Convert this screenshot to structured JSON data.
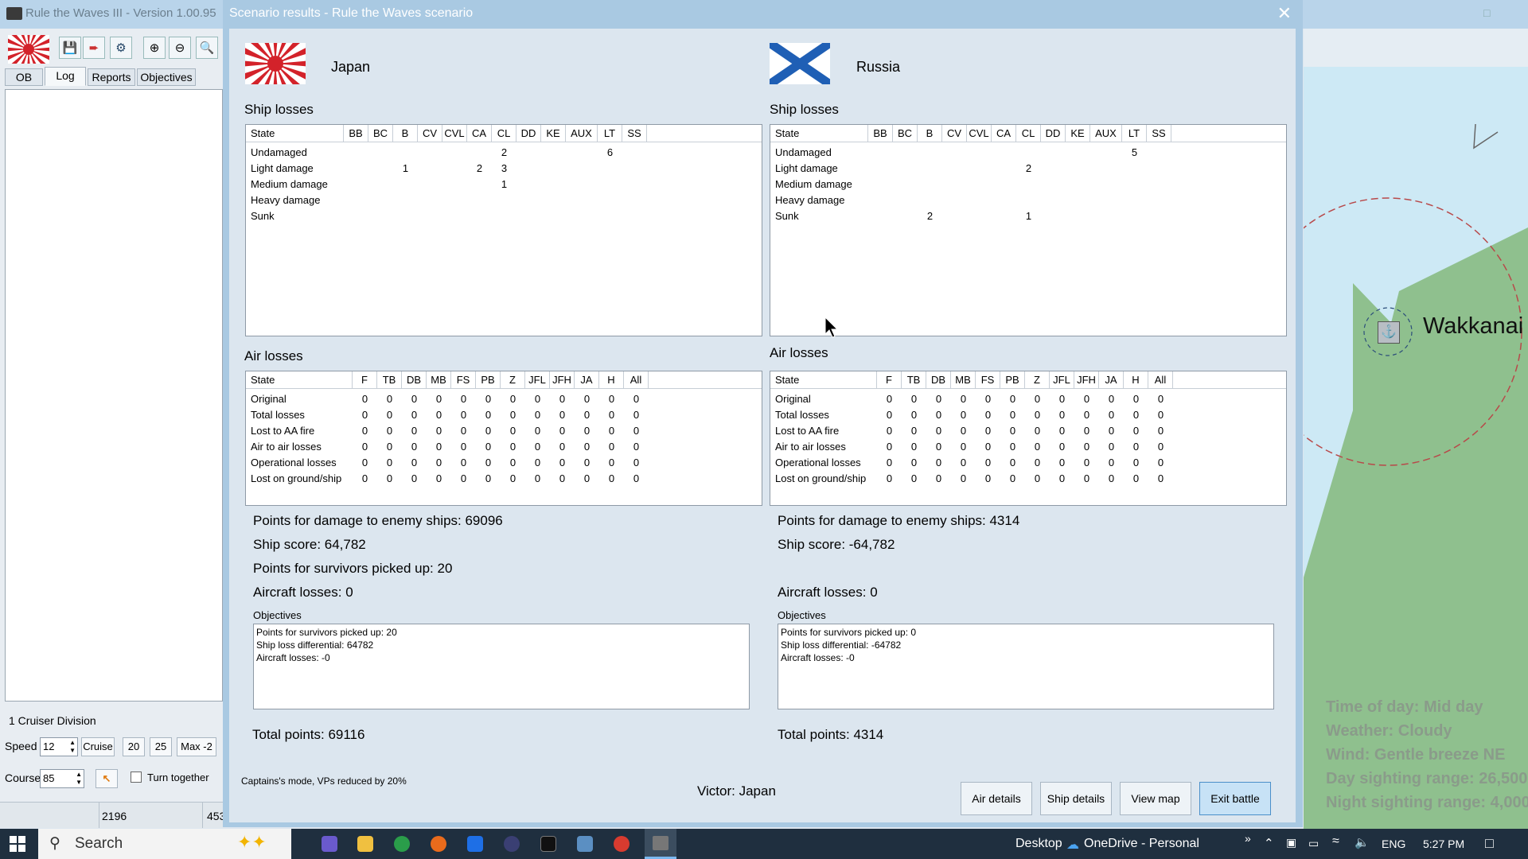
{
  "app": {
    "title": "Rule the Waves III - Version 1.00.95",
    "tabs": [
      "OB",
      "Log",
      "Reports",
      "Objectives"
    ],
    "active_tab": "Log",
    "unit_name": "1 Cruiser Division",
    "speed_label": "Speed",
    "speed_value": "12",
    "speed_buttons": [
      "Cruise",
      "20",
      "25",
      "Max -2"
    ],
    "course_label": "Course",
    "course_value": "85",
    "turn_together_label": "Turn together",
    "status_values": [
      "2196",
      "453"
    ]
  },
  "map": {
    "place_name": "Wakkanai",
    "info": {
      "time": "Time of day: Mid day",
      "weather": "Weather: Cloudy",
      "wind": "Wind: Gentle breeze  NE",
      "day_range": "Day sighting range: 26,500",
      "night_range": "Night sighting range: 4,000"
    }
  },
  "dialog": {
    "title": "Scenario results - Rule the Waves scenario",
    "ship_losses_title": "Ship losses",
    "air_losses_title": "Air losses",
    "ship_columns": [
      "State",
      "BB",
      "BC",
      "B",
      "CV",
      "CVL",
      "CA",
      "CL",
      "DD",
      "KE",
      "AUX",
      "LT",
      "SS"
    ],
    "air_columns": [
      "State",
      "F",
      "TB",
      "DB",
      "MB",
      "FS",
      "PB",
      "Z",
      "JFL",
      "JFH",
      "JA",
      "H",
      "All"
    ],
    "objectives_label": "Objectives",
    "captains_mode_note": "Captains's mode, VPs reduced by 20%",
    "victor": "Victor: Japan",
    "buttons": {
      "air_details": "Air details",
      "ship_details": "Ship details",
      "view_map": "View map",
      "exit_battle": "Exit battle"
    }
  },
  "japan": {
    "name": "Japan",
    "ship_rows": [
      [
        "Undamaged",
        "",
        "",
        "",
        "",
        "",
        "",
        "2",
        "",
        "",
        "",
        "6",
        ""
      ],
      [
        "Light damage",
        "",
        "",
        "1",
        "",
        "",
        "2",
        "3",
        "",
        "",
        "",
        "",
        ""
      ],
      [
        "Medium damage",
        "",
        "",
        "",
        "",
        "",
        "",
        "1",
        "",
        "",
        "",
        "",
        ""
      ],
      [
        "Heavy damage",
        "",
        "",
        "",
        "",
        "",
        "",
        "",
        "",
        "",
        "",
        "",
        ""
      ],
      [
        "Sunk",
        "",
        "",
        "",
        "",
        "",
        "",
        "",
        "",
        "",
        "",
        "",
        ""
      ]
    ],
    "air_rows": [
      [
        "Original",
        "0",
        "0",
        "0",
        "0",
        "0",
        "0",
        "0",
        "0",
        "0",
        "0",
        "0",
        "0"
      ],
      [
        "Total losses",
        "0",
        "0",
        "0",
        "0",
        "0",
        "0",
        "0",
        "0",
        "0",
        "0",
        "0",
        "0"
      ],
      [
        "Lost to AA fire",
        "0",
        "0",
        "0",
        "0",
        "0",
        "0",
        "0",
        "0",
        "0",
        "0",
        "0",
        "0"
      ],
      [
        "Air to air losses",
        "0",
        "0",
        "0",
        "0",
        "0",
        "0",
        "0",
        "0",
        "0",
        "0",
        "0",
        "0"
      ],
      [
        "Operational losses",
        "0",
        "0",
        "0",
        "0",
        "0",
        "0",
        "0",
        "0",
        "0",
        "0",
        "0",
        "0"
      ],
      [
        "Lost on ground/ship",
        "0",
        "0",
        "0",
        "0",
        "0",
        "0",
        "0",
        "0",
        "0",
        "0",
        "0",
        "0"
      ]
    ],
    "points_damage": "Points for damage to enemy ships: 69096",
    "ship_score": "Ship score: 64,782",
    "points_survivors": "Points for survivors picked up: 20",
    "aircraft_losses": "Aircraft losses: 0",
    "objectives": [
      "Points for survivors picked up: 20",
      "Ship loss differential: 64782",
      "Aircraft losses: -0"
    ],
    "total_points": "Total points: 69116"
  },
  "russia": {
    "name": "Russia",
    "ship_rows": [
      [
        "Undamaged",
        "",
        "",
        "",
        "",
        "",
        "",
        "",
        "",
        "",
        "",
        "5",
        ""
      ],
      [
        "Light damage",
        "",
        "",
        "",
        "",
        "",
        "",
        "2",
        "",
        "",
        "",
        "",
        ""
      ],
      [
        "Medium damage",
        "",
        "",
        "",
        "",
        "",
        "",
        "",
        "",
        "",
        "",
        "",
        ""
      ],
      [
        "Heavy damage",
        "",
        "",
        "",
        "",
        "",
        "",
        "",
        "",
        "",
        "",
        "",
        ""
      ],
      [
        "Sunk",
        "",
        "",
        "2",
        "",
        "",
        "",
        "1",
        "",
        "",
        "",
        "",
        ""
      ]
    ],
    "air_rows": [
      [
        "Original",
        "0",
        "0",
        "0",
        "0",
        "0",
        "0",
        "0",
        "0",
        "0",
        "0",
        "0",
        "0"
      ],
      [
        "Total losses",
        "0",
        "0",
        "0",
        "0",
        "0",
        "0",
        "0",
        "0",
        "0",
        "0",
        "0",
        "0"
      ],
      [
        "Lost to AA fire",
        "0",
        "0",
        "0",
        "0",
        "0",
        "0",
        "0",
        "0",
        "0",
        "0",
        "0",
        "0"
      ],
      [
        "Air to air losses",
        "0",
        "0",
        "0",
        "0",
        "0",
        "0",
        "0",
        "0",
        "0",
        "0",
        "0",
        "0"
      ],
      [
        "Operational losses",
        "0",
        "0",
        "0",
        "0",
        "0",
        "0",
        "0",
        "0",
        "0",
        "0",
        "0",
        "0"
      ],
      [
        "Lost on ground/ship",
        "0",
        "0",
        "0",
        "0",
        "0",
        "0",
        "0",
        "0",
        "0",
        "0",
        "0",
        "0"
      ]
    ],
    "points_damage": "Points for damage to enemy ships: 4314",
    "ship_score": "Ship score: -64,782",
    "aircraft_losses": "Aircraft losses: 0",
    "objectives": [
      "Points for survivors picked up: 0",
      "Ship loss differential: -64782",
      "Aircraft losses: -0"
    ],
    "total_points": "Total points: 4314"
  },
  "taskbar": {
    "search_placeholder": "Search",
    "desktop_label": "Desktop",
    "onedrive_label": "OneDrive - Personal",
    "language": "ENG",
    "time": "5:27 PM"
  },
  "colors": {
    "dialog_frame": "#a9c9e2",
    "dialog_body": "#dce6ef",
    "land": "#8fc08e",
    "range_circle": "#b8494a",
    "exit_button_border": "#4a8fc9"
  }
}
